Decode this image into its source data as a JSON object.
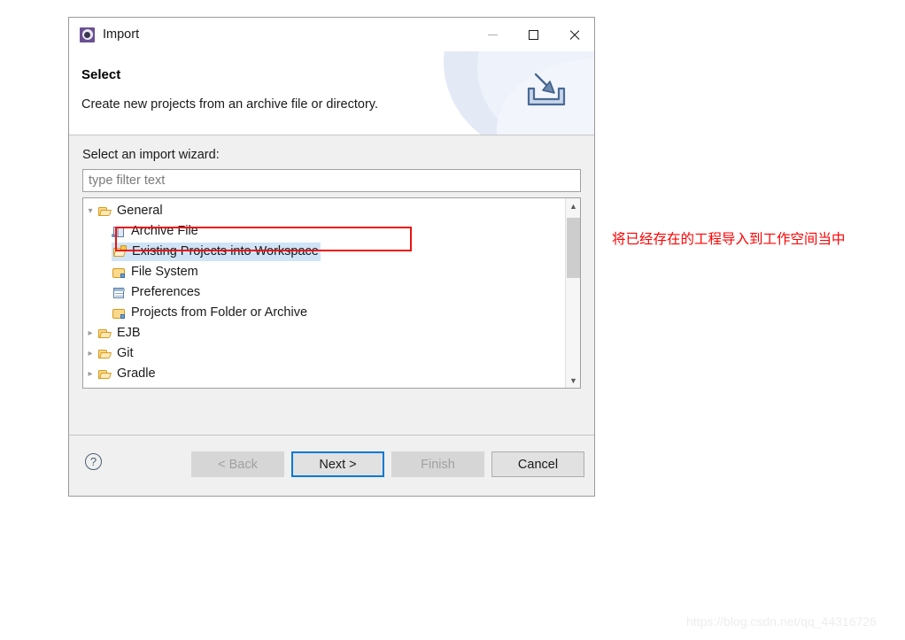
{
  "window": {
    "title": "Import",
    "icon": "eclipse-import-icon",
    "controls": {
      "minimize": "minimize-icon",
      "maximize": "maximize-icon",
      "close": "close-icon"
    }
  },
  "header": {
    "title": "Select",
    "description": "Create new projects from an archive file or directory.",
    "banner_icon": "import-tray-arrow-icon"
  },
  "body": {
    "wizard_label": "Select an import wizard:",
    "filter": {
      "value": "",
      "placeholder": "type filter text"
    },
    "tree": [
      {
        "label": "General",
        "level": 0,
        "twisty": "expanded",
        "icon": "folder-open-icon",
        "selected": false
      },
      {
        "label": "Archive File",
        "level": 1,
        "twisty": "none",
        "icon": "archive-file-icon",
        "selected": false
      },
      {
        "label": "Existing Projects into Workspace",
        "level": 1,
        "twisty": "none",
        "icon": "folder-star-icon",
        "selected": true
      },
      {
        "label": "File System",
        "level": 1,
        "twisty": "none",
        "icon": "folder-closed-icon",
        "selected": false
      },
      {
        "label": "Preferences",
        "level": 1,
        "twisty": "none",
        "icon": "preferences-icon",
        "selected": false
      },
      {
        "label": "Projects from Folder or Archive",
        "level": 1,
        "twisty": "none",
        "icon": "folder-closed-icon",
        "selected": false
      },
      {
        "label": "EJB",
        "level": 0,
        "twisty": "collapsed",
        "icon": "folder-open-icon",
        "selected": false
      },
      {
        "label": "Git",
        "level": 0,
        "twisty": "collapsed",
        "icon": "folder-open-icon",
        "selected": false
      },
      {
        "label": "Gradle",
        "level": 0,
        "twisty": "collapsed",
        "icon": "folder-open-icon",
        "selected": false
      }
    ],
    "scrollbar": {
      "up_arrow": "chevron-up-icon",
      "down_arrow": "chevron-down-icon"
    }
  },
  "footer": {
    "help": "?",
    "buttons": [
      {
        "label": "< Back",
        "state": "disabled"
      },
      {
        "label": "Next >",
        "state": "focused"
      },
      {
        "label": "Finish",
        "state": "disabled"
      },
      {
        "label": "Cancel",
        "state": "normal"
      }
    ]
  },
  "annotation": {
    "text": "将已经存在的工程导入到工作空间当中",
    "color": "#ff0000"
  },
  "watermark": {
    "text": "https://blog.csdn.net/qq_44316726"
  }
}
